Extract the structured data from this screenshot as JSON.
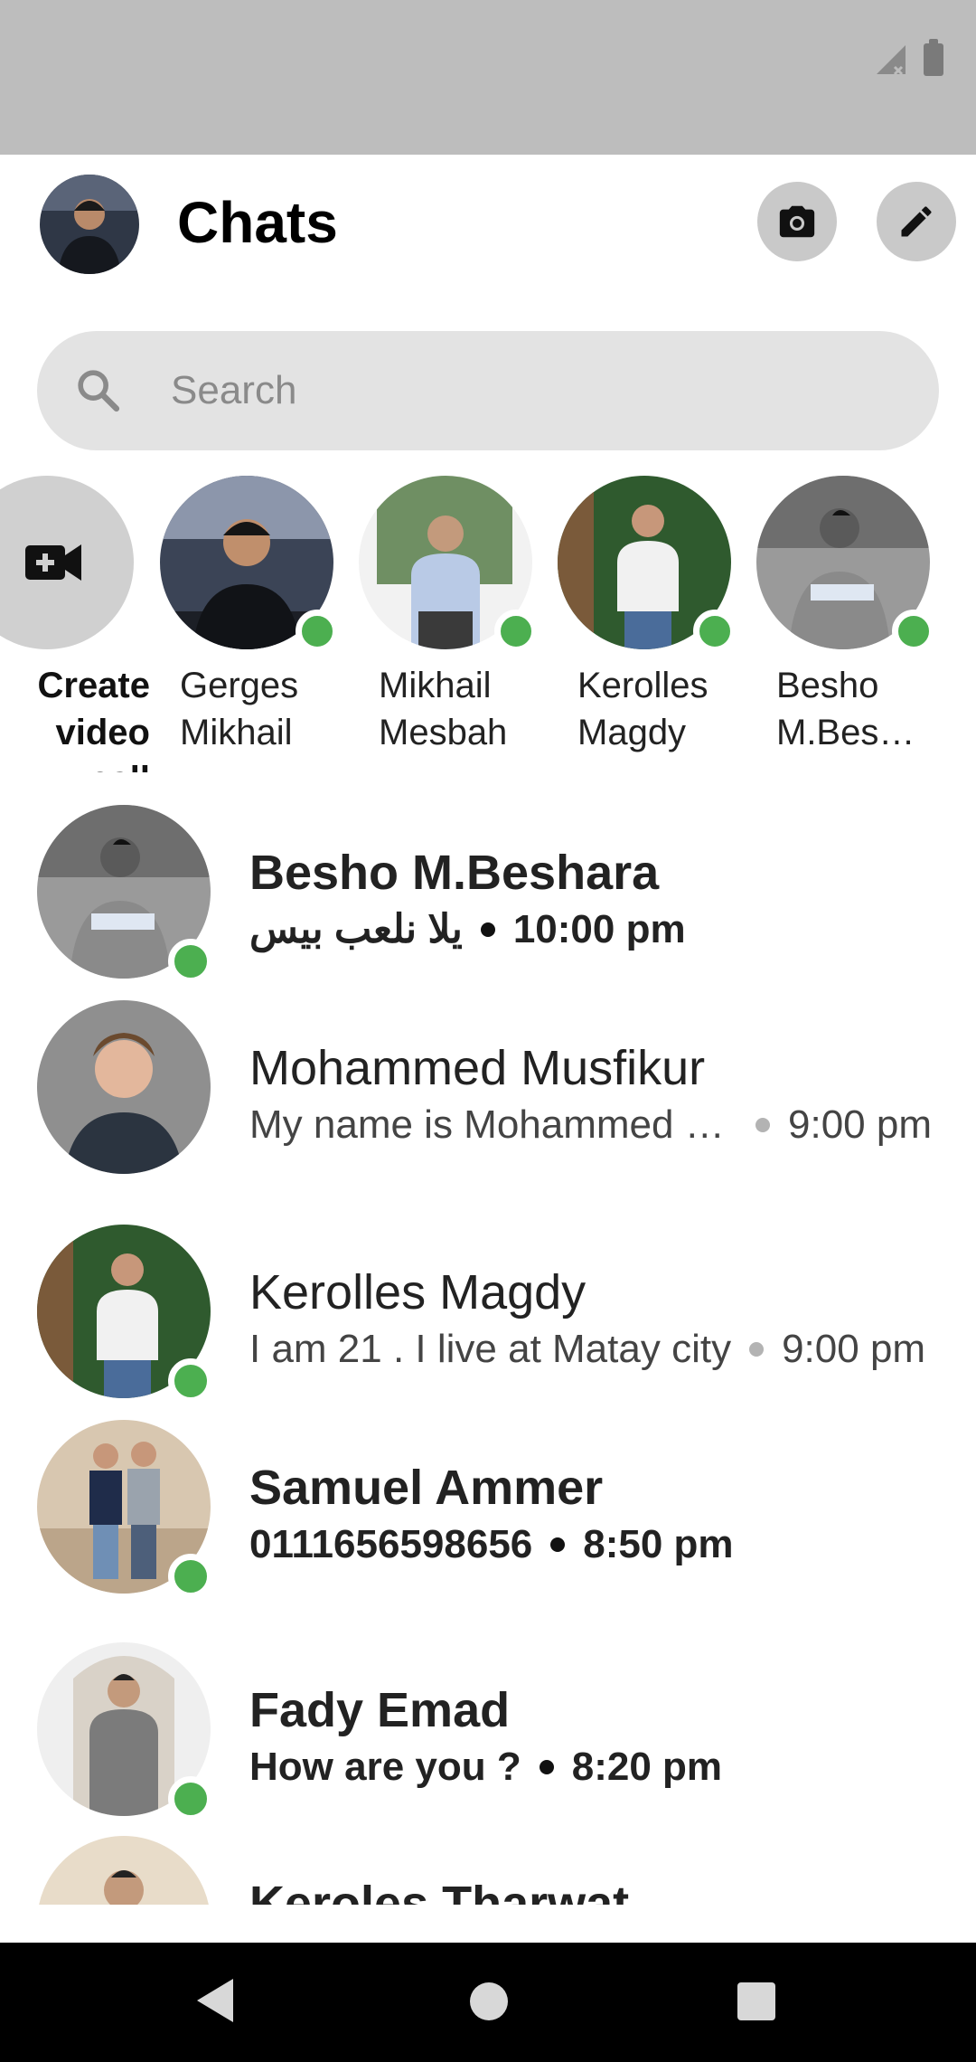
{
  "header": {
    "title": "Chats"
  },
  "search": {
    "placeholder": "Search"
  },
  "stories": [
    {
      "label": "Create video\ncall",
      "type": "video"
    },
    {
      "label": "Gerges\nMikhail",
      "online": true
    },
    {
      "label": "Mikhail\nMesbah",
      "online": true
    },
    {
      "label": "Kerolles\nMagdy",
      "online": true
    },
    {
      "label": "Besho\nM.Bes…",
      "online": true
    }
  ],
  "chats": [
    {
      "name": "Besho M.Beshara",
      "message": "يلا نلعب بيس",
      "time": "10:00 pm",
      "unread": true,
      "online": true
    },
    {
      "name": "Mohammed Musfikur",
      "message": "My name is Mohammed Musfikur",
      "time": "9:00 pm",
      "unread": false,
      "online": false
    },
    {
      "name": "Kerolles Magdy",
      "message": "I am 21 . I live at Matay city",
      "time": "9:00 pm",
      "unread": false,
      "online": true
    },
    {
      "name": "Samuel Ammer",
      "message": "0111656598656",
      "time": "8:50 pm",
      "unread": true,
      "online": true
    },
    {
      "name": "Fady Emad",
      "message": "How are you ?",
      "time": "8:20 pm",
      "unread": true,
      "online": true
    },
    {
      "name": "Keroles Tharwat",
      "message": "",
      "time": "",
      "unread": true,
      "online": false
    }
  ],
  "colors": {
    "online": "#4caf50",
    "statusBar": "#bdbdbd",
    "searchBg": "#e3e3e3",
    "iconButtonBg": "#c9c9c9"
  },
  "icons": {
    "camera": "camera-icon",
    "compose": "pencil-icon",
    "search": "search-icon",
    "video": "video-camera-icon"
  }
}
